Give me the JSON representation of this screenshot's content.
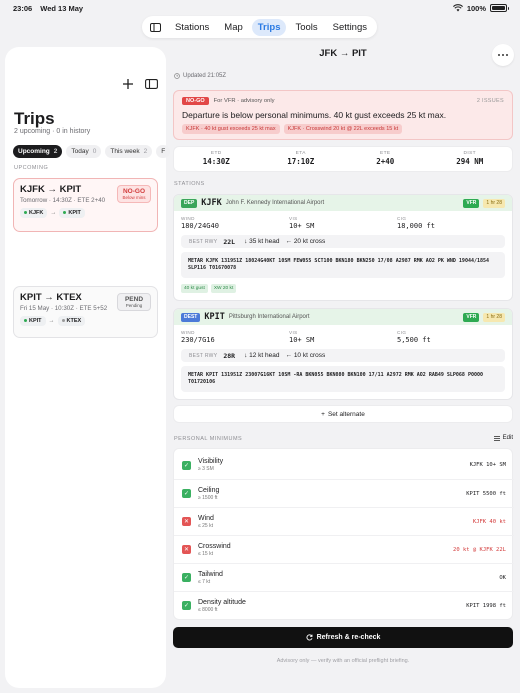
{
  "status_bar": {
    "time": "23:06",
    "date": "Wed 13 May",
    "battery": "100%"
  },
  "top_nav": {
    "tabs": [
      {
        "label": "Stations",
        "active": false
      },
      {
        "label": "Map",
        "active": false
      },
      {
        "label": "Trips",
        "active": true
      },
      {
        "label": "Tools",
        "active": false
      },
      {
        "label": "Settings",
        "active": false
      }
    ]
  },
  "sidebar": {
    "title": "Trips",
    "subtitle": "2 upcoming · 0 in history",
    "filters": [
      {
        "label": "Upcoming",
        "count": "2"
      },
      {
        "label": "Today",
        "count": "0"
      },
      {
        "label": "This week",
        "count": "2"
      },
      {
        "label": "F",
        "count": ""
      }
    ],
    "section_label": "UPCOMING",
    "trips": [
      {
        "route": "KJFK → KPIT",
        "meta": "Tomorrow · 14:30Z · ETE 2+40",
        "status": "NO-GO",
        "status_sub": "Below mins",
        "from": "KJFK",
        "to": "KPIT"
      },
      {
        "route": "KPIT → KTEX",
        "meta": "Fri 15 May · 10:30Z · ETE 5+52",
        "status": "PEND",
        "status_sub": "Pending",
        "from": "KPIT",
        "to": "KTEX"
      }
    ]
  },
  "main": {
    "title": "JFK → PIT",
    "updated": "Updated 21:05Z",
    "alert": {
      "tag": "NO-GO",
      "for": "For VFR · advisory only",
      "issues": "2 ISSUES",
      "message": "Departure is below personal minimums. 40 kt gust exceeds 25 kt max.",
      "tags": [
        "KJFK · 40 kt gust exceeds 25 kt max",
        "KJFK · Crosswind 20 kt @ 22L exceeds 15 kt"
      ]
    },
    "times": [
      {
        "label": "ETD",
        "value": "14:30Z"
      },
      {
        "label": "ETA",
        "value": "17:10Z"
      },
      {
        "label": "ETE",
        "value": "2+40"
      },
      {
        "label": "DIST",
        "value": "294 NM"
      }
    ],
    "stations_label": "STATIONS",
    "stations": [
      {
        "role": "DEP",
        "icao": "KJFK",
        "name": "John F. Kennedy International Airport",
        "category": "VFR",
        "age": "1 hr 28",
        "wind_label": "WIND",
        "wind": "180/24G40",
        "vis_label": "VIS",
        "vis": "10+ SM",
        "cig_label": "CIG",
        "cig": "18,000 ft",
        "rwy_label": "BEST RWY",
        "rwy": "22L",
        "head": "↓ 35 kt head",
        "cross": "← 20 kt cross",
        "metar": "METAR KJFK 131951Z 18024G40KT 10SM FEW055 SCT100 BKN180 BKN250 17/08 A2987 RMK AO2 PK WND 19044/1854 SLP116 T01670078",
        "tags": [
          "40 kt gust",
          "XW 20 kt"
        ]
      },
      {
        "role": "DEST",
        "icao": "KPIT",
        "name": "Pittsburgh International Airport",
        "category": "VFR",
        "age": "1 hr 28",
        "wind_label": "WIND",
        "wind": "230/7G16",
        "vis_label": "VIS",
        "vis": "10+ SM",
        "cig_label": "CIG",
        "cig": "5,500 ft",
        "rwy_label": "BEST RWY",
        "rwy": "28R",
        "head": "↓ 12 kt head",
        "cross": "← 10 kt cross",
        "metar": "METAR KPIT 131951Z 23007G16KT 10SM -RA BKN055 BKN080 BKN100 17/11 A2972 RMK AO2 RAB49 SLP068 P0000 T01720106",
        "tags": []
      }
    ],
    "set_alternate": "Set alternate",
    "minimums_label": "PERSONAL MINIMUMS",
    "edit_label": "Edit",
    "minimums": [
      {
        "name": "Visibility",
        "limit": "≥ 3 SM",
        "ok": true,
        "result": "KJFK 10+ SM"
      },
      {
        "name": "Ceiling",
        "limit": "≥ 1500 ft",
        "ok": true,
        "result": "KPIT 5500 ft"
      },
      {
        "name": "Wind",
        "limit": "≤ 25 kt",
        "ok": false,
        "result": "KJFK 40 kt"
      },
      {
        "name": "Crosswind",
        "limit": "≤ 15 kt",
        "ok": false,
        "result": "20 kt @ KJFK 22L"
      },
      {
        "name": "Tailwind",
        "limit": "≤ 7 kt",
        "ok": true,
        "result": "OK"
      },
      {
        "name": "Density altitude",
        "limit": "≤ 8000 ft",
        "ok": true,
        "result": "KPIT 1998 ft"
      }
    ],
    "refresh_label": "Refresh & re-check",
    "footer": "Advisory only — verify with an official preflight briefing."
  },
  "colors": {
    "accent": "#2a7ae4",
    "nogo": "#e24646",
    "vfr": "#2eaa52"
  }
}
